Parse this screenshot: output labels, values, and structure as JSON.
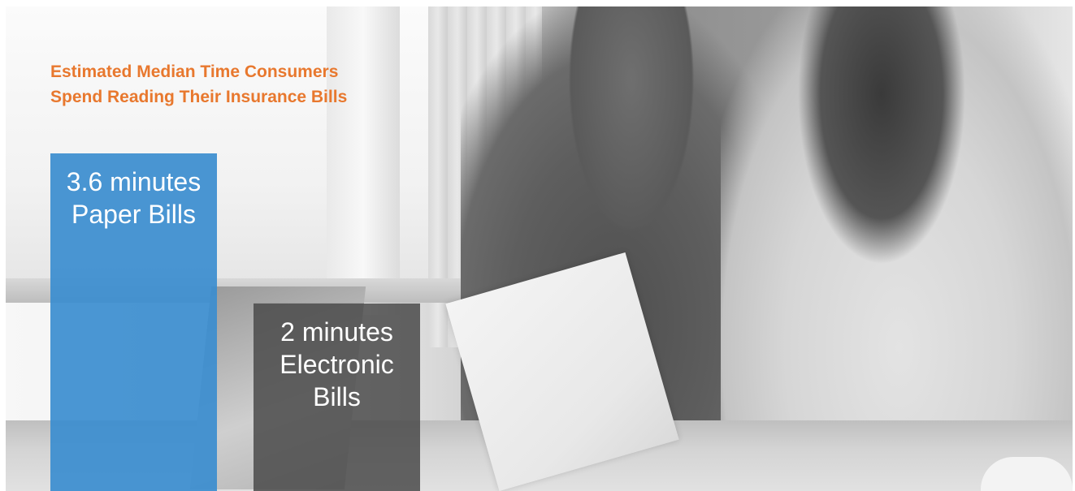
{
  "colors": {
    "title": "#e8782e",
    "paper_bar": "#3b8dcf",
    "electronic_bar": "#4a4a4a",
    "label_text": "#ffffff"
  },
  "chart_data": {
    "type": "bar",
    "title": "Estimated Median Time Consumers\nSpend Reading Their Insurance Bills",
    "unit": "minutes",
    "categories": [
      "Paper Bills",
      "Electronic Bills"
    ],
    "values": [
      3.6,
      2
    ],
    "ylim": [
      0,
      3.6
    ],
    "grid": false,
    "legend": "none",
    "series": [
      {
        "values": [
          3.6,
          2
        ],
        "labels": [
          [
            "3.6 minutes",
            "Paper Bills"
          ],
          [
            "2 minutes",
            "Electronic",
            "Bills"
          ]
        ],
        "colors": [
          "#3b8dcf",
          "#4a4a4a"
        ]
      }
    ]
  }
}
